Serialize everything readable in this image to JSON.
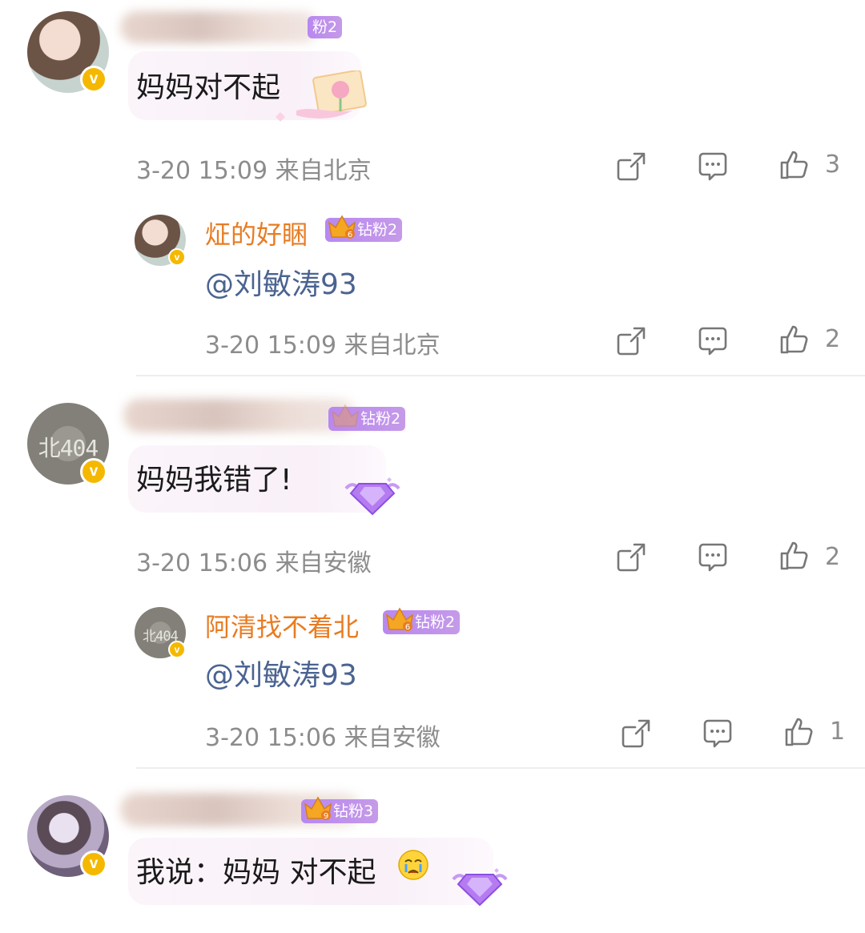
{
  "comments": [
    {
      "text": "妈妈对不起",
      "fan_badge": "粉2",
      "time": "3-20 15:09",
      "location": "来自北京",
      "likes": "3",
      "reply": {
        "username": "炡的好睏",
        "fan_badge": "钻粉2",
        "text": "@刘敏涛93",
        "time": "3-20 15:09",
        "location": "来自北京",
        "likes": "2"
      }
    },
    {
      "text": "妈妈我错了!",
      "avatar_text": "北404",
      "fan_badge": "钻粉2",
      "time": "3-20 15:06",
      "location": "来自安徽",
      "likes": "2",
      "reply": {
        "username": "阿清找不着北",
        "avatar_text": "北404",
        "fan_badge": "钻粉2",
        "text": "@刘敏涛93",
        "time": "3-20 15:06",
        "location": "来自安徽",
        "likes": "1"
      }
    },
    {
      "text": "我说：妈妈 对不起",
      "fan_badge": "钻粉3"
    }
  ],
  "crown_levels": [
    "6",
    "6",
    "6",
    "6",
    "9"
  ],
  "colors": {
    "username": "#e87c22",
    "mention": "#4a6391",
    "meta": "#8c8c8c",
    "fan_badge": "#b888f0",
    "verified": "#f5b800"
  },
  "icons": [
    "share-icon",
    "comment-icon",
    "like-icon",
    "verified-icon",
    "crown-icon",
    "gem-icon"
  ]
}
